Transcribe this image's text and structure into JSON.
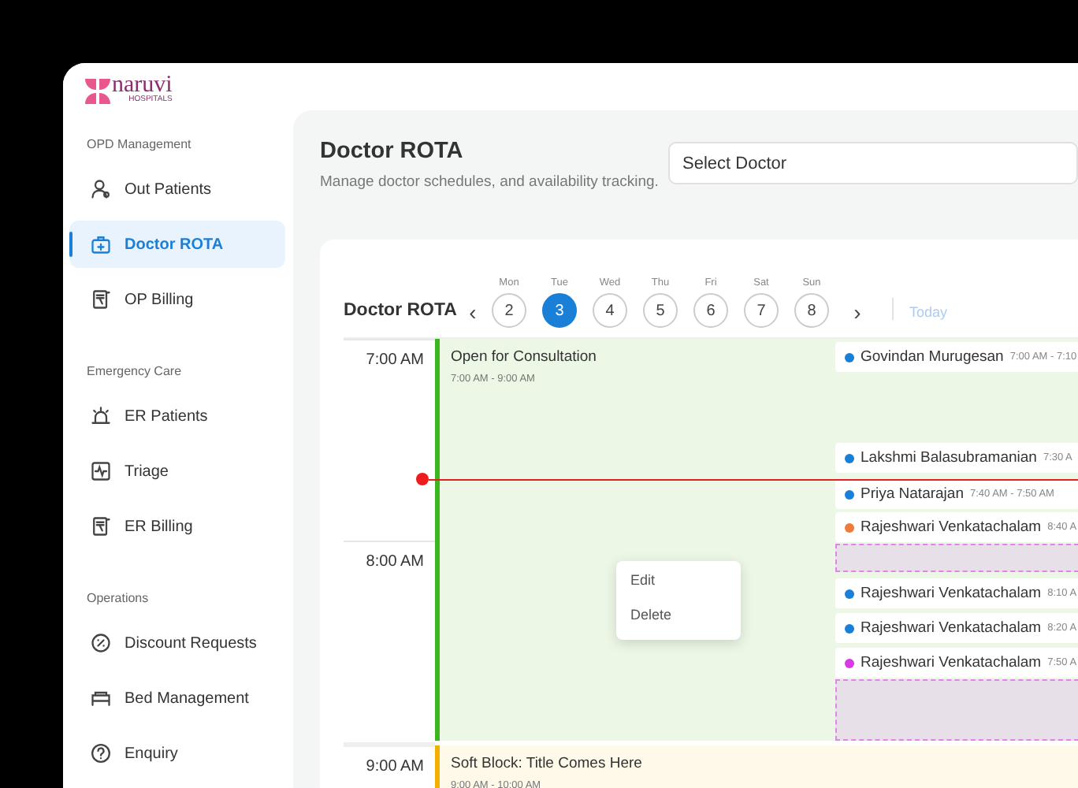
{
  "logo": {
    "name": "naruvi",
    "tagline": "HOSPITALS"
  },
  "sidebar": {
    "sections": [
      {
        "title": "OPD Management",
        "items": [
          {
            "label": "Out Patients",
            "selected": false
          },
          {
            "label": "Doctor ROTA",
            "selected": true
          },
          {
            "label": "OP Billing",
            "selected": false
          }
        ]
      },
      {
        "title": "Emergency Care",
        "items": [
          {
            "label": "ER Patients",
            "selected": false
          },
          {
            "label": "Triage",
            "selected": false
          },
          {
            "label": "ER Billing",
            "selected": false
          }
        ]
      },
      {
        "title": "Operations",
        "items": [
          {
            "label": "Discount Requests",
            "selected": false
          },
          {
            "label": "Bed Management",
            "selected": false
          },
          {
            "label": "Enquiry",
            "selected": false
          }
        ]
      }
    ]
  },
  "page": {
    "title": "Doctor ROTA",
    "subtitle": "Manage doctor schedules, and availability tracking.",
    "doctor_select": {
      "label": "Select Doctor"
    }
  },
  "calendar": {
    "title": "Doctor ROTA",
    "prev": "‹",
    "next": "›",
    "today": "Today",
    "days": [
      {
        "weekday": "Mon",
        "date": "2",
        "selected": false
      },
      {
        "weekday": "Tue",
        "date": "3",
        "selected": true
      },
      {
        "weekday": "Wed",
        "date": "4",
        "selected": false
      },
      {
        "weekday": "Thu",
        "date": "5",
        "selected": false
      },
      {
        "weekday": "Fri",
        "date": "6",
        "selected": false
      },
      {
        "weekday": "Sat",
        "date": "7",
        "selected": false
      },
      {
        "weekday": "Sun",
        "date": "8",
        "selected": false
      }
    ],
    "hours": [
      "7:00 AM",
      "8:00 AM",
      "9:00 AM"
    ],
    "blocks": [
      {
        "kind": "open",
        "title": "Open for Consultation",
        "time": "7:00 AM - 9:00 AM"
      },
      {
        "kind": "soft",
        "title": "Soft Block: Title Comes Here",
        "time": "9:00 AM - 10:00 AM"
      }
    ],
    "appointments": [
      {
        "kind": "appointment",
        "name": "Govindan Murugesan",
        "time": "7:00 AM - 7:10",
        "color": "#1a7fd6"
      },
      {
        "kind": "appointment",
        "name": "Lakshmi Balasubramanian",
        "time": "7:30 A",
        "color": "#1a7fd6"
      },
      {
        "kind": "appointment",
        "name": "Priya Natarajan",
        "time": "7:40 AM - 7:50 AM",
        "color": "#1a7fd6"
      },
      {
        "kind": "appointment",
        "name": "Rajeshwari Venkatachalam",
        "time": "8:40 A",
        "color": "#f07a3a"
      },
      {
        "kind": "blocked"
      },
      {
        "kind": "appointment",
        "name": "Rajeshwari Venkatachalam",
        "time": "8:10 A",
        "color": "#1a7fd6"
      },
      {
        "kind": "appointment",
        "name": "Rajeshwari Venkatachalam",
        "time": "8:20 A",
        "color": "#1a7fd6"
      },
      {
        "kind": "appointment",
        "name": "Rajeshwari Venkatachalam",
        "time": "7:50 A",
        "color": "#d63ce0"
      },
      {
        "kind": "blocked"
      }
    ],
    "context_menu": [
      "Edit",
      "Delete"
    ]
  }
}
